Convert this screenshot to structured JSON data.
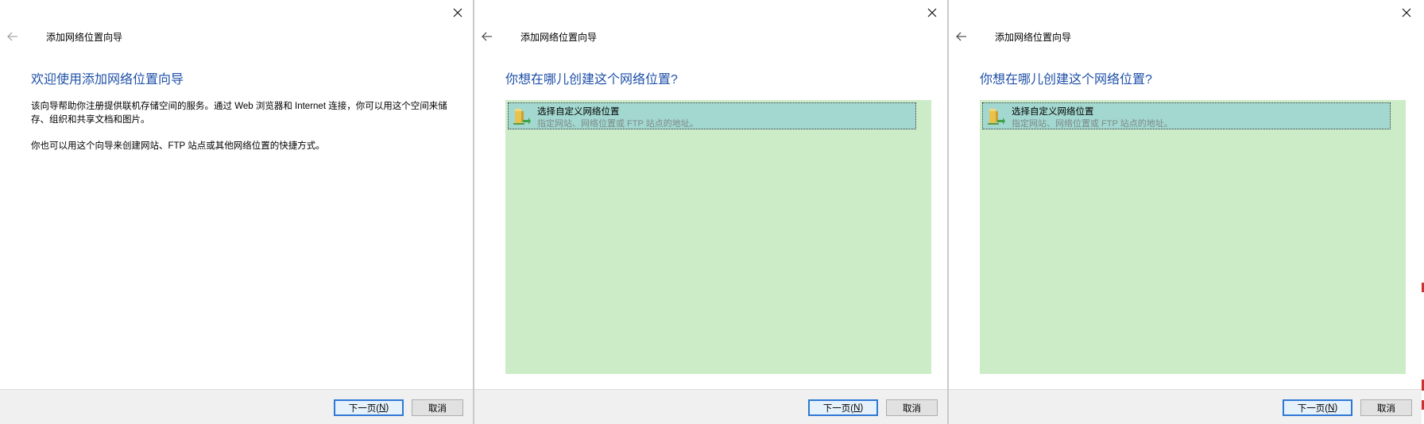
{
  "wizard_panels": [
    {
      "window_title": "添加网络位置向导",
      "heading": "欢迎使用添加网络位置向导",
      "paragraphs": [
        "该向导帮助你注册提供联机存储空间的服务。通过 Web 浏览器和 Internet 连接，你可以用这个空间来储存、组织和共享文档和图片。",
        "你也可以用这个向导来创建网站、FTP 站点或其他网络位置的快捷方式。"
      ],
      "buttons": {
        "next_prefix": "下一页(",
        "next_mnemonic": "N",
        "next_suffix": ")",
        "cancel": "取消"
      }
    },
    {
      "window_title": "添加网络位置向导",
      "heading": "你想在哪儿创建这个网络位置?",
      "list_items": [
        {
          "title": "选择自定义网络位置",
          "description": "指定网站、网络位置或 FTP 站点的地址。",
          "icon": "folder-network-icon"
        }
      ],
      "buttons": {
        "next_prefix": "下一页(",
        "next_mnemonic": "N",
        "next_suffix": ")",
        "cancel": "取消"
      }
    },
    {
      "window_title": "添加网络位置向导",
      "heading": "你想在哪儿创建这个网络位置?",
      "list_items": [
        {
          "title": "选择自定义网络位置",
          "description": "指定网站、网络位置或 FTP 站点的地址。",
          "icon": "folder-network-icon"
        }
      ],
      "buttons": {
        "next_prefix": "下一页(",
        "next_mnemonic": "N",
        "next_suffix": ")",
        "cancel": "取消"
      }
    }
  ],
  "colors": {
    "heading": "#1e4fa8",
    "list_background": "#ccecc8",
    "selected_item": "#a3d8d0",
    "default_button_border": "#2f78d6",
    "footer": "#f0f0f0"
  }
}
